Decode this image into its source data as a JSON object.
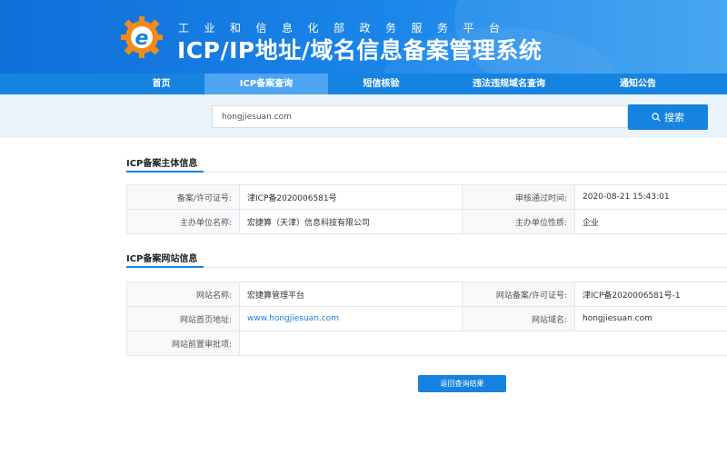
{
  "header": {
    "subtitle": "工业和信息化部政务服务平台",
    "title": "ICP/IP地址/域名信息备案管理系统",
    "colors": {
      "primary": "#1683e0",
      "logo_orange": "#f08a1c"
    }
  },
  "nav": {
    "items": [
      {
        "label": "首页"
      },
      {
        "label": "ICP备案查询"
      },
      {
        "label": "短信核验"
      },
      {
        "label": "违法违规域名查询"
      },
      {
        "label": "通知公告"
      }
    ],
    "active_index": 1
  },
  "search": {
    "value": "hongjiesuan.com",
    "button_label": "搜索",
    "button_icon": "search-icon"
  },
  "subject_section": {
    "title": "ICP备案主体信息",
    "rows": [
      {
        "label1": "备案/许可证号:",
        "value1": "津ICP备2020006581号",
        "label2": "审核通过时间:",
        "value2": "2020-08-21 15:43:01"
      },
      {
        "label1": "主办单位名称:",
        "value1": "宏捷算（天津）信息科技有限公司",
        "label2": "主办单位性质:",
        "value2": "企业"
      }
    ]
  },
  "website_section": {
    "title": "ICP备案网站信息",
    "rows": [
      {
        "label1": "网站名称:",
        "value1": "宏捷算管理平台",
        "label2": "网站备案/许可证号:",
        "value2": "津ICP备2020006581号-1"
      },
      {
        "label1": "网站首页地址:",
        "value1": "www.hongjiesuan.com",
        "label2": "网站域名:",
        "value2": "hongjiesuan.com"
      },
      {
        "label1": "网站前置审批项:",
        "value1": ""
      }
    ]
  },
  "back_button_label": "返回查询结果"
}
